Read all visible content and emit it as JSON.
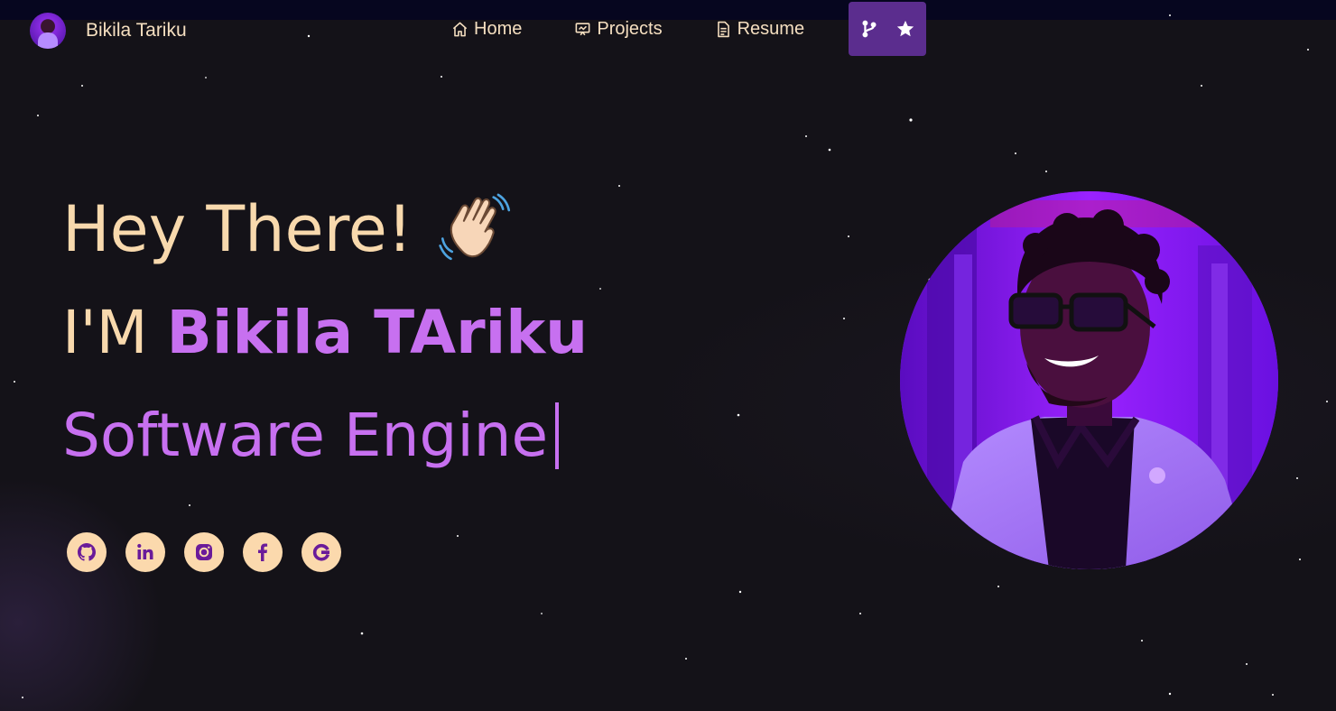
{
  "brand": {
    "name": "Bikila Tariku",
    "logo_icon": "profile-avatar-icon"
  },
  "nav": {
    "items": [
      {
        "label": "Home",
        "icon": "home-icon"
      },
      {
        "label": "Projects",
        "icon": "presentation-icon"
      },
      {
        "label": "Resume",
        "icon": "document-icon"
      }
    ],
    "fork_button": {
      "icons": [
        "git-branch-icon",
        "star-icon"
      ]
    }
  },
  "hero": {
    "greeting": "Hey There!",
    "greeting_emoji": "waving-hand-icon",
    "intro_prefix": "I'M",
    "intro_name": "Bikila TAriku",
    "typed_text": "Software Engine"
  },
  "socials": [
    {
      "name": "GitHub",
      "icon": "github-icon"
    },
    {
      "name": "LinkedIn",
      "icon": "linkedin-icon"
    },
    {
      "name": "Instagram",
      "icon": "instagram-icon"
    },
    {
      "name": "Facebook",
      "icon": "facebook-icon"
    },
    {
      "name": "Google",
      "icon": "google-icon"
    }
  ],
  "colors": {
    "background": "#141218",
    "accent_purple": "#c770f0",
    "cream": "#f8d9ad",
    "fork_button_bg": "#5b2d8e",
    "top_strip": "#06061f"
  }
}
